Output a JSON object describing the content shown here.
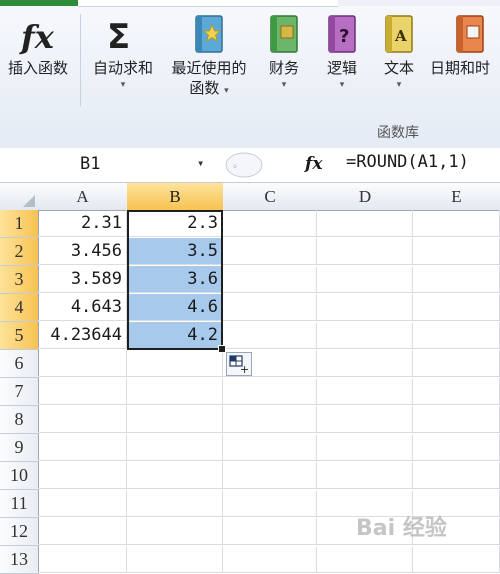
{
  "ribbon": {
    "buttons": [
      {
        "label": "插入函数",
        "icon": "fx-icon",
        "dropdown": false
      },
      {
        "label": "自动求和",
        "icon": "sigma-icon",
        "dropdown": true
      },
      {
        "label": "最近使用的",
        "label2": "函数",
        "icon": "recent-book-icon",
        "dropdown": true
      },
      {
        "label": "财务",
        "icon": "finance-book-icon",
        "dropdown": true
      },
      {
        "label": "逻辑",
        "icon": "logic-book-icon",
        "dropdown": true
      },
      {
        "label": "文本",
        "icon": "text-book-icon",
        "dropdown": true
      },
      {
        "label": "日期和时",
        "icon": "date-book-icon",
        "dropdown": false
      }
    ],
    "group_label": "函数库",
    "fx_glyph": "fx",
    "sigma_glyph": "Σ",
    "dropdown_glyph": "▾"
  },
  "formula_bar": {
    "name_box": "B1",
    "fx_label": "fx",
    "formula": "=ROUND(A1,1)"
  },
  "grid": {
    "columns": [
      "A",
      "B",
      "C",
      "D",
      "E"
    ],
    "selected_column": "B",
    "rows": [
      "1",
      "2",
      "3",
      "4",
      "5",
      "6",
      "7",
      "8",
      "9",
      "10",
      "11",
      "12",
      "13"
    ],
    "cells": [
      {
        "row": 1,
        "A": "2.31",
        "B": "2.3"
      },
      {
        "row": 2,
        "A": "3.456",
        "B": "3.5"
      },
      {
        "row": 3,
        "A": "3.589",
        "B": "3.6"
      },
      {
        "row": 4,
        "A": "4.643",
        "B": "4.6"
      },
      {
        "row": 5,
        "A": "4.23644",
        "B": "4.2"
      }
    ]
  },
  "watermark": "Bai 经验"
}
